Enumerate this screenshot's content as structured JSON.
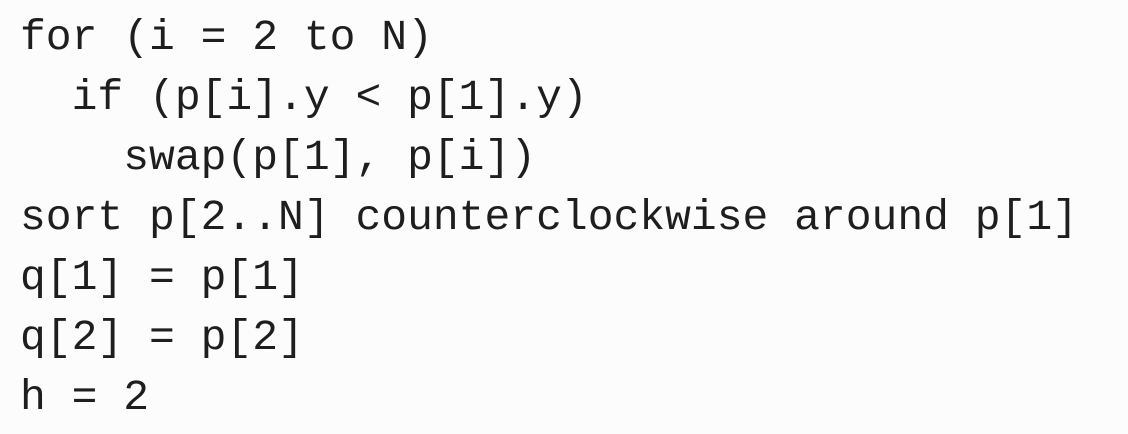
{
  "code": {
    "lines": [
      "for (i = 2 to N)",
      "  if (p[i].y < p[1].y)",
      "    swap(p[1], p[i])",
      "sort p[2..N] counterclockwise around p[1]",
      "q[1] = p[1]",
      "q[2] = p[2]",
      "h = 2"
    ]
  }
}
